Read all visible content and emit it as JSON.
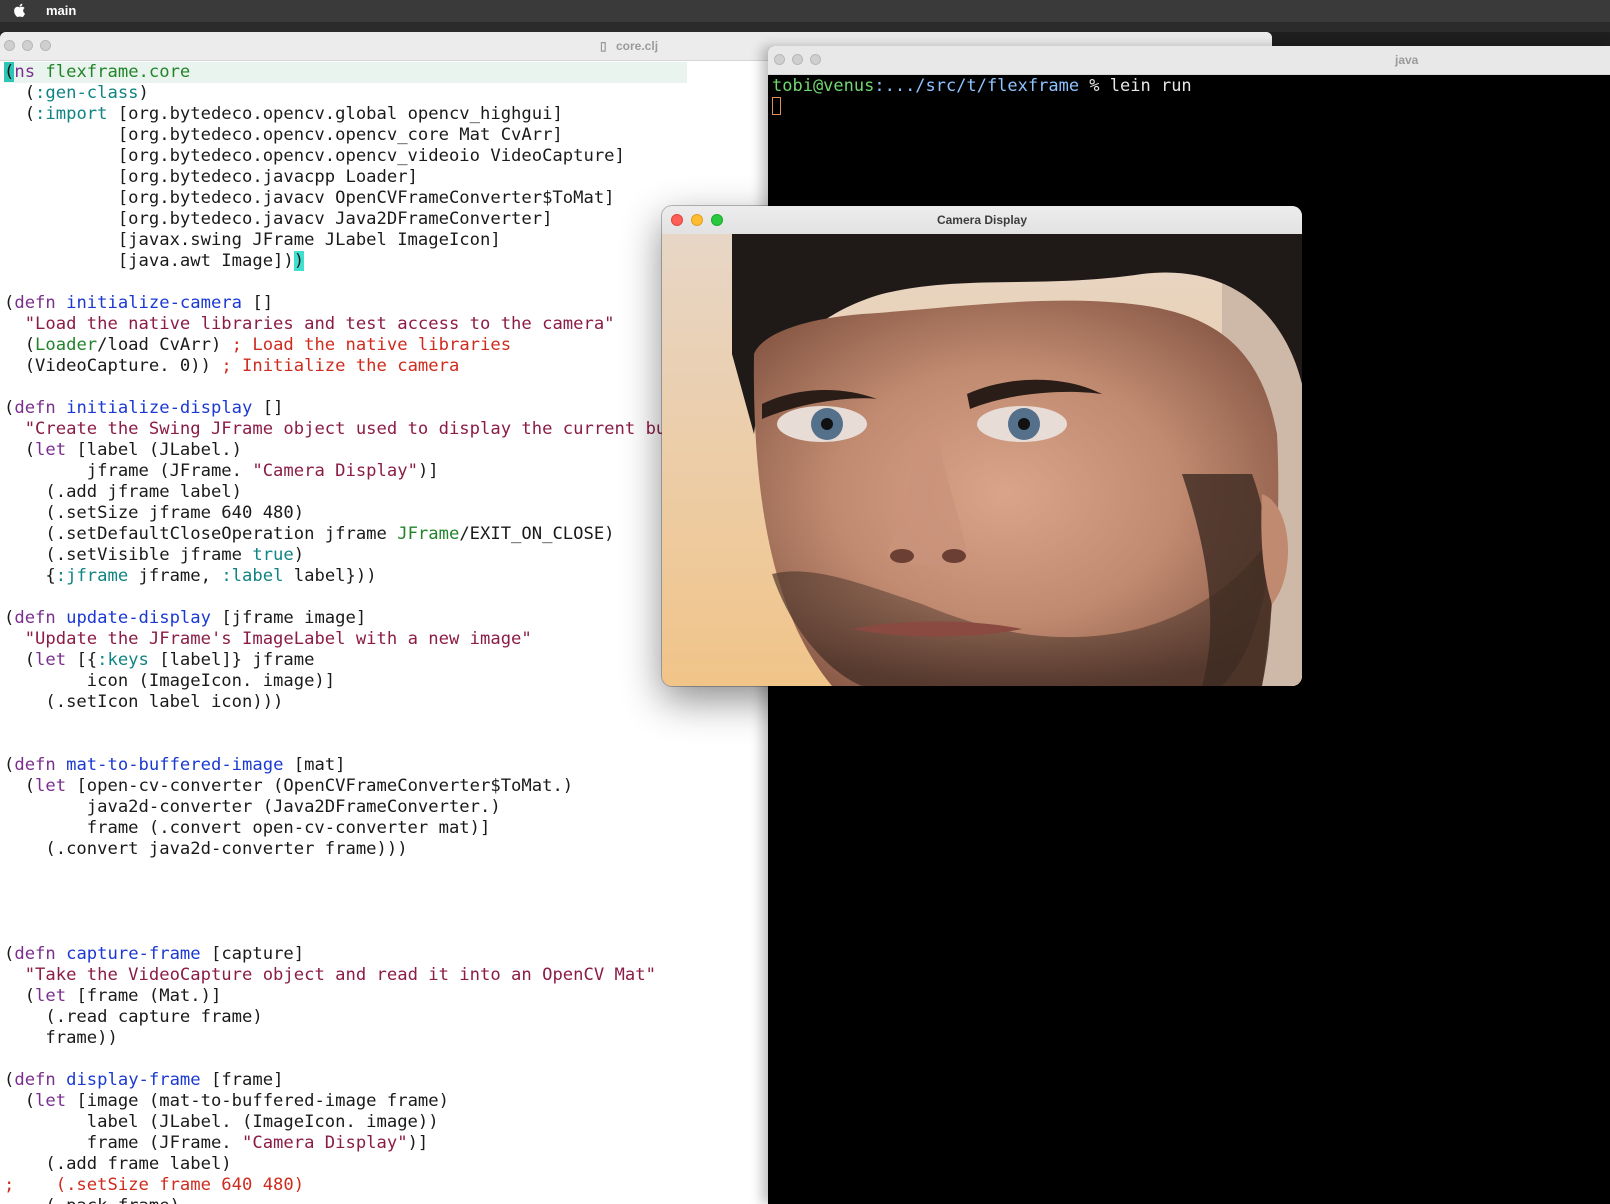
{
  "menubar": {
    "app_name": "main"
  },
  "editor": {
    "title": "core.clj",
    "lines": [
      [
        [
          "cur",
          "("
        ],
        [
          "kw",
          "ns "
        ],
        [
          "sym",
          "flexframe.core"
        ]
      ],
      [
        [
          "",
          "  ("
        ],
        [
          "kwd",
          ":gen-class"
        ],
        [
          "",
          ")"
        ]
      ],
      [
        [
          "",
          "  ("
        ],
        [
          "kwd",
          ":import"
        ],
        [
          "",
          " [org.bytedeco.opencv.global opencv_highgui]"
        ]
      ],
      [
        [
          "",
          "           [org.bytedeco.opencv.opencv_core Mat CvArr]"
        ]
      ],
      [
        [
          "",
          "           [org.bytedeco.opencv.opencv_videoio VideoCapture]"
        ]
      ],
      [
        [
          "",
          "           [org.bytedeco.javacpp Loader]"
        ]
      ],
      [
        [
          "",
          "           [org.bytedeco.javacv OpenCVFrameConverter$ToMat]"
        ]
      ],
      [
        [
          "",
          "           [org.bytedeco.javacv Java2DFrameConverter]"
        ]
      ],
      [
        [
          "",
          "           [javax.swing JFrame JLabel ImageIcon]"
        ]
      ],
      [
        [
          "",
          "           [java.awt Image])"
        ],
        [
          "par",
          ")"
        ]
      ],
      [
        [
          "",
          ""
        ]
      ],
      [
        [
          "",
          "("
        ],
        [
          "kw",
          "defn "
        ],
        [
          "fn",
          "initialize-camera"
        ],
        [
          "",
          " []"
        ]
      ],
      [
        [
          "",
          "  "
        ],
        [
          "str",
          "\"Load the native libraries and test access to the camera\""
        ]
      ],
      [
        [
          "",
          "  ("
        ],
        [
          "sym",
          "Loader"
        ],
        [
          "",
          "/load CvArr) "
        ],
        [
          "cm",
          "; Load the native libraries"
        ]
      ],
      [
        [
          "",
          "  (VideoCapture. 0)) "
        ],
        [
          "cm",
          "; Initialize the camera"
        ]
      ],
      [
        [
          "",
          ""
        ]
      ],
      [
        [
          "",
          "("
        ],
        [
          "kw",
          "defn "
        ],
        [
          "fn",
          "initialize-display"
        ],
        [
          "",
          " []"
        ]
      ],
      [
        [
          "",
          "  "
        ],
        [
          "str",
          "\"Create the Swing JFrame object used to display the current buff"
        ]
      ],
      [
        [
          "",
          "  ("
        ],
        [
          "kw",
          "let"
        ],
        [
          "",
          " [label (JLabel.)"
        ]
      ],
      [
        [
          "",
          "        jframe (JFrame. "
        ],
        [
          "str",
          "\"Camera Display\""
        ],
        [
          "",
          ")]"
        ]
      ],
      [
        [
          "",
          "    (.add jframe label)"
        ]
      ],
      [
        [
          "",
          "    (.setSize jframe 640 480)"
        ]
      ],
      [
        [
          "",
          "    (.setDefaultCloseOperation jframe "
        ],
        [
          "sym",
          "JFrame"
        ],
        [
          "",
          "/EXIT_ON_CLOSE)"
        ]
      ],
      [
        [
          "",
          "    (.setVisible jframe "
        ],
        [
          "bool",
          "true"
        ],
        [
          "",
          ")"
        ]
      ],
      [
        [
          "",
          "    {"
        ],
        [
          "kwd",
          ":jframe"
        ],
        [
          "",
          " jframe, "
        ],
        [
          "kwd",
          ":label"
        ],
        [
          "",
          " label}))"
        ]
      ],
      [
        [
          "",
          ""
        ]
      ],
      [
        [
          "",
          "("
        ],
        [
          "kw",
          "defn "
        ],
        [
          "fn",
          "update-display"
        ],
        [
          "",
          " [jframe image]"
        ]
      ],
      [
        [
          "",
          "  "
        ],
        [
          "str",
          "\"Update the JFrame's ImageLabel with a new image\""
        ]
      ],
      [
        [
          "",
          "  ("
        ],
        [
          "kw",
          "let"
        ],
        [
          "",
          " [{"
        ],
        [
          "kwd",
          ":keys"
        ],
        [
          "",
          " [label]} jframe"
        ]
      ],
      [
        [
          "",
          "        icon (ImageIcon. image)]"
        ]
      ],
      [
        [
          "",
          "    (.setIcon label icon)))"
        ]
      ],
      [
        [
          "",
          ""
        ]
      ],
      [
        [
          "",
          ""
        ]
      ],
      [
        [
          "",
          "("
        ],
        [
          "kw",
          "defn "
        ],
        [
          "fn",
          "mat-to-buffered-image"
        ],
        [
          "",
          " [mat]"
        ]
      ],
      [
        [
          "",
          "  ("
        ],
        [
          "kw",
          "let"
        ],
        [
          "",
          " [open-cv-converter (OpenCVFrameConverter$ToMat.)"
        ]
      ],
      [
        [
          "",
          "        java2d-converter (Java2DFrameConverter.)"
        ]
      ],
      [
        [
          "",
          "        frame (.convert open-cv-converter mat)]"
        ]
      ],
      [
        [
          "",
          "    (.convert java2d-converter frame)))"
        ]
      ],
      [
        [
          "",
          ""
        ]
      ],
      [
        [
          "",
          ""
        ]
      ],
      [
        [
          "",
          ""
        ]
      ],
      [
        [
          "",
          ""
        ]
      ],
      [
        [
          "",
          "("
        ],
        [
          "kw",
          "defn "
        ],
        [
          "fn",
          "capture-frame"
        ],
        [
          "",
          " [capture]"
        ]
      ],
      [
        [
          "",
          "  "
        ],
        [
          "str",
          "\"Take the VideoCapture object and read it into an OpenCV Mat\""
        ]
      ],
      [
        [
          "",
          "  ("
        ],
        [
          "kw",
          "let"
        ],
        [
          "",
          " [frame (Mat.)]"
        ]
      ],
      [
        [
          "",
          "    (.read capture frame)"
        ]
      ],
      [
        [
          "",
          "    frame))"
        ]
      ],
      [
        [
          "",
          ""
        ]
      ],
      [
        [
          "",
          "("
        ],
        [
          "kw",
          "defn "
        ],
        [
          "fn",
          "display-frame"
        ],
        [
          "",
          " [frame]"
        ]
      ],
      [
        [
          "",
          "  ("
        ],
        [
          "kw",
          "let"
        ],
        [
          "",
          " [image (mat-to-buffered-image frame)"
        ]
      ],
      [
        [
          "",
          "        label (JLabel. (ImageIcon. image))"
        ]
      ],
      [
        [
          "",
          "        frame (JFrame. "
        ],
        [
          "str",
          "\"Camera Display\""
        ],
        [
          "",
          ")]"
        ]
      ],
      [
        [
          "",
          "    (.add frame label)"
        ]
      ],
      [
        [
          "cm",
          ";    (.setSize frame 640 480)"
        ]
      ],
      [
        [
          "",
          "    (.pack frame)"
        ]
      ],
      [
        [
          "cm",
          "    (.setDefaultCloseOperation frame JFrame/EXIT_ON_CLOSE)"
        ]
      ]
    ]
  },
  "terminal": {
    "title": "java",
    "prompt_user": "tobi@venus",
    "prompt_path": ":.../src/t/flexframe",
    "prompt_symbol": " % ",
    "command": "lein run"
  },
  "camera_window": {
    "title": "Camera Display"
  }
}
